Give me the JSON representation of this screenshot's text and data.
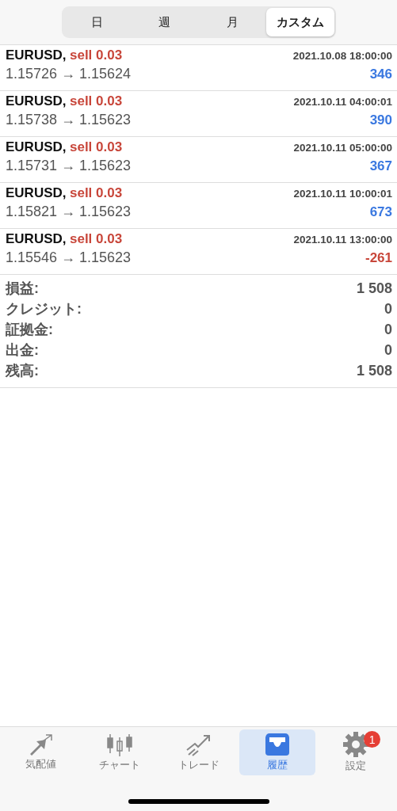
{
  "period_tabs": [
    {
      "label": "日",
      "selected": false
    },
    {
      "label": "週",
      "selected": false
    },
    {
      "label": "月",
      "selected": false
    },
    {
      "label": "カスタム",
      "selected": true
    }
  ],
  "deals": [
    {
      "symbol": "EURUSD,",
      "side": "sell 0.03",
      "time": "2021.10.08 18:00:00",
      "prices": "1.15726 → 1.15624",
      "profit": "346",
      "kind": "gain"
    },
    {
      "symbol": "EURUSD,",
      "side": "sell 0.03",
      "time": "2021.10.11 04:00:01",
      "prices": "1.15738 → 1.15623",
      "profit": "390",
      "kind": "gain"
    },
    {
      "symbol": "EURUSD,",
      "side": "sell 0.03",
      "time": "2021.10.11 05:00:00",
      "prices": "1.15731 → 1.15623",
      "profit": "367",
      "kind": "gain"
    },
    {
      "symbol": "EURUSD,",
      "side": "sell 0.03",
      "time": "2021.10.11 10:00:01",
      "prices": "1.15821 → 1.15623",
      "profit": "673",
      "kind": "gain"
    },
    {
      "symbol": "EURUSD,",
      "side": "sell 0.03",
      "time": "2021.10.11 13:00:00",
      "prices": "1.15546 → 1.15623",
      "profit": "-261",
      "kind": "loss"
    }
  ],
  "summary": [
    {
      "label": "損益:",
      "value": "1 508"
    },
    {
      "label": "クレジット:",
      "value": "0"
    },
    {
      "label": "証拠金:",
      "value": "0"
    },
    {
      "label": "出金:",
      "value": "0"
    },
    {
      "label": "残高:",
      "value": "1 508"
    }
  ],
  "tab_bar": [
    {
      "label": "気配値",
      "kind": "quotes",
      "selected": false
    },
    {
      "label": "チャート",
      "kind": "chart",
      "selected": false
    },
    {
      "label": "トレード",
      "kind": "trade",
      "selected": false
    },
    {
      "label": "履歴",
      "kind": "history",
      "selected": true
    },
    {
      "label": "設定",
      "kind": "settings",
      "selected": false,
      "badge": "1"
    }
  ]
}
